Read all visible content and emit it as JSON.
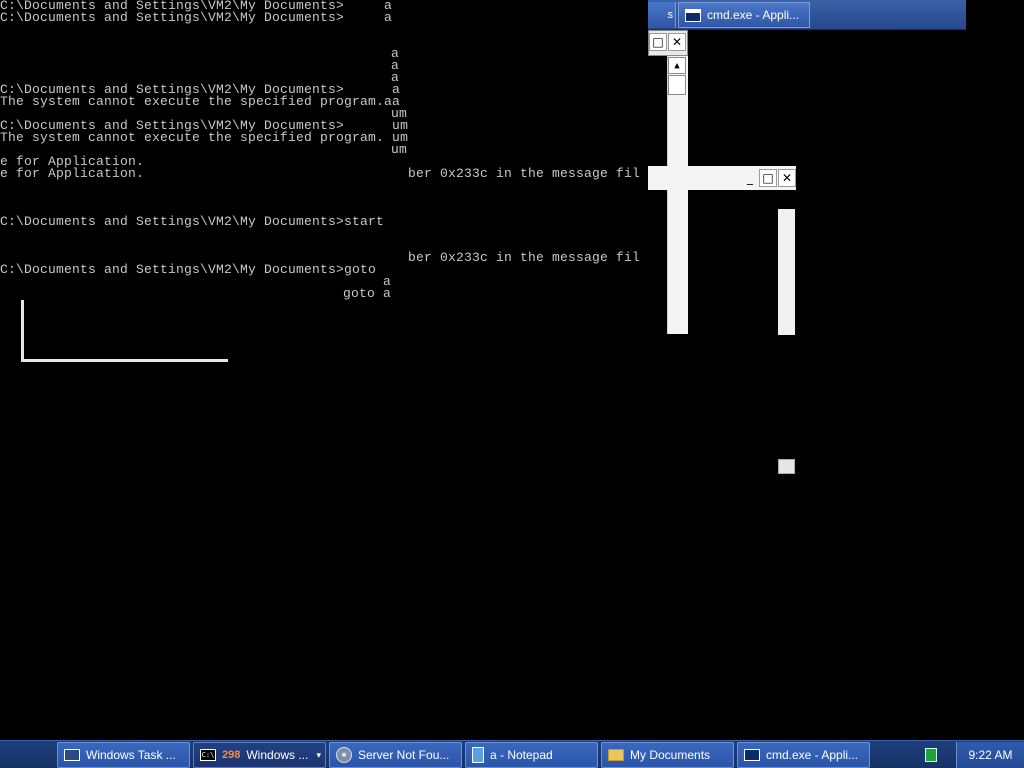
{
  "console": {
    "lines": [
      "C:\\Documents and Settings\\VM2\\My Documents>     a",
      "C:\\Documents and Settings\\VM2\\My Documents>     a",
      "a",
      "a",
      "a",
      "C:\\Documents and Settings\\VM2\\My Documents>      a",
      "The system cannot execute the specified program.aa",
      "um",
      "C:\\Documents and Settings\\VM2\\My Documents>      um",
      "The system cannot execute the specified program. um",
      "um",
      "e for Application.",
      "e for Application.",
      "ber 0x233c in the message fil",
      "C:\\Documents and Settings\\VM2\\My Documents>start",
      "ber 0x233c in the message fil",
      "C:\\Documents and Settings\\VM2\\My Documents>goto",
      "a",
      "goto a"
    ]
  },
  "fragment": {
    "top_tab_label": "cmd.exe - Appli...",
    "top_stub_label": "s",
    "minimize": "_",
    "maximize": "□",
    "close": "✕",
    "scroll_up": "▲"
  },
  "taskbar": {
    "items": [
      {
        "label": "Windows Task ...",
        "icon": "monitor-icon"
      },
      {
        "label": "Windows ...",
        "badge": "298",
        "icon": "cmd-icon",
        "active": true
      },
      {
        "label": "Server Not Fou...",
        "icon": "globe-icon"
      },
      {
        "label": "a - Notepad",
        "icon": "notepad-icon"
      },
      {
        "label": "My Documents",
        "icon": "folder-icon"
      },
      {
        "label": "cmd.exe - Appli...",
        "icon": "cmd-window-icon"
      }
    ],
    "cmd_icon_text": "C:\\",
    "clock": "9:22 AM"
  }
}
